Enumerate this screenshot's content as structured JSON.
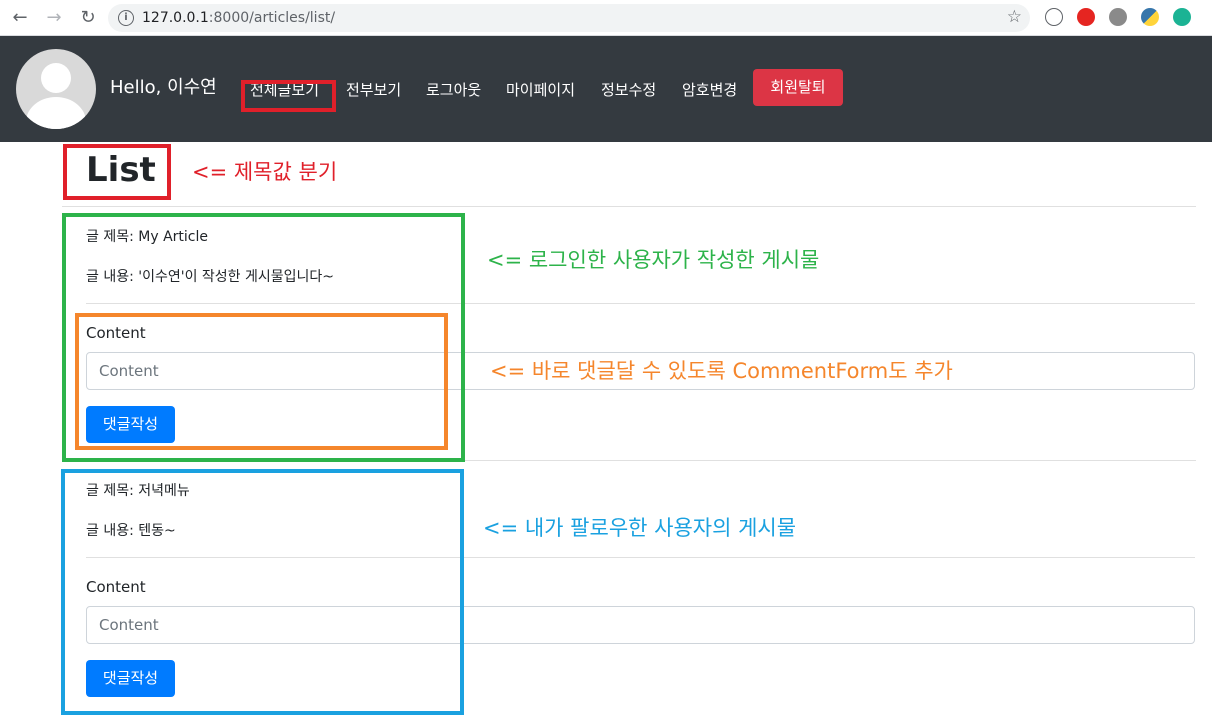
{
  "browser": {
    "url_host": "127.0.0.1",
    "url_rest": ":8000/articles/list/"
  },
  "nav": {
    "greeting": "Hello, 이수연",
    "links": [
      "전체글보기",
      "전부보기",
      "로그아웃",
      "마이페이지",
      "정보수정",
      "암호변경"
    ],
    "withdraw_label": "회원탈퇴"
  },
  "page_title": "List",
  "articles": [
    {
      "title": "글 제목: My Article",
      "content": "글 내용: '이수연'이 작성한 게시물입니다~",
      "comment_label": "Content",
      "comment_placeholder": "Content",
      "submit_label": "댓글작성"
    },
    {
      "title": "글 제목: 저녁메뉴",
      "content": "글 내용: 텐동~",
      "comment_label": "Content",
      "comment_placeholder": "Content",
      "submit_label": "댓글작성"
    }
  ],
  "annotations": {
    "title_note": "<= 제목값 분기",
    "own_post_note": "<= 로그인한 사용자가 작성한 게시물",
    "comment_form_note": "<= 바로 댓글달 수 있도록 CommentForm도 추가",
    "followed_post_note": "<= 내가 팔로우한 사용자의 게시물"
  },
  "colors": {
    "navbar": "#343a40",
    "danger": "#dc3545",
    "primary": "#007bff",
    "annot_red": "#e0202a",
    "annot_green": "#2db34a",
    "annot_orange": "#f5862c",
    "annot_blue": "#1aa1e0"
  }
}
